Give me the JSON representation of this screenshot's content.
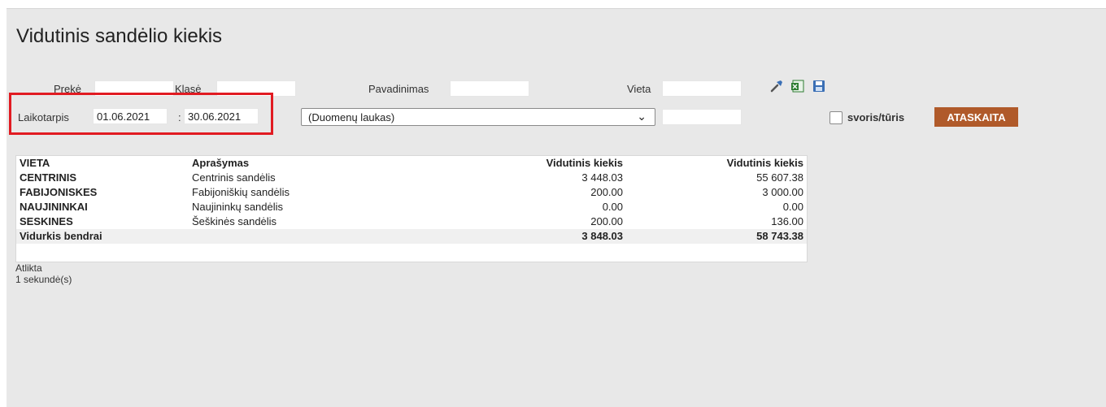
{
  "page": {
    "title": "Vidutinis sandėlio kiekis"
  },
  "filters": {
    "preke_label": "Prekė",
    "klase_label": "Klasė",
    "pavadinimas_label": "Pavadinimas",
    "vieta_label": "Vieta",
    "laikotarpis_label": "Laikotarpis",
    "date_from": "01.06.2021",
    "date_sep": ":",
    "date_to": "30.06.2021",
    "dropdown_value": "(Duomenų laukas)",
    "checkbox_label": "svoris/tūris",
    "report_button": "ATASKAITA"
  },
  "icons": [
    "wrench-icon",
    "excel-icon",
    "save-icon"
  ],
  "table": {
    "headers": [
      "VIETA",
      "Aprašymas",
      "Vidutinis kiekis",
      "Vidutinis kiekis"
    ],
    "rows": [
      [
        "CENTRINIS",
        "Centrinis sandėlis",
        "3 448.03",
        "55 607.38"
      ],
      [
        "FABIJONISKES",
        "Fabijoniškių sandėlis",
        "200.00",
        "3 000.00"
      ],
      [
        "NAUJININKAI",
        "Naujininkų sandėlis",
        "0.00",
        "0.00"
      ],
      [
        "SESKINES",
        "Šeškinės sandėlis",
        "200.00",
        "136.00"
      ]
    ],
    "total": [
      "Vidurkis bendrai",
      "",
      "3 848.03",
      "58 743.38"
    ]
  },
  "status": {
    "line1": "Atlikta",
    "line2": "1 sekundė(s)"
  },
  "colors": {
    "highlight": "#e11b22",
    "button": "#b05a2a",
    "background": "#e8e8e8"
  }
}
